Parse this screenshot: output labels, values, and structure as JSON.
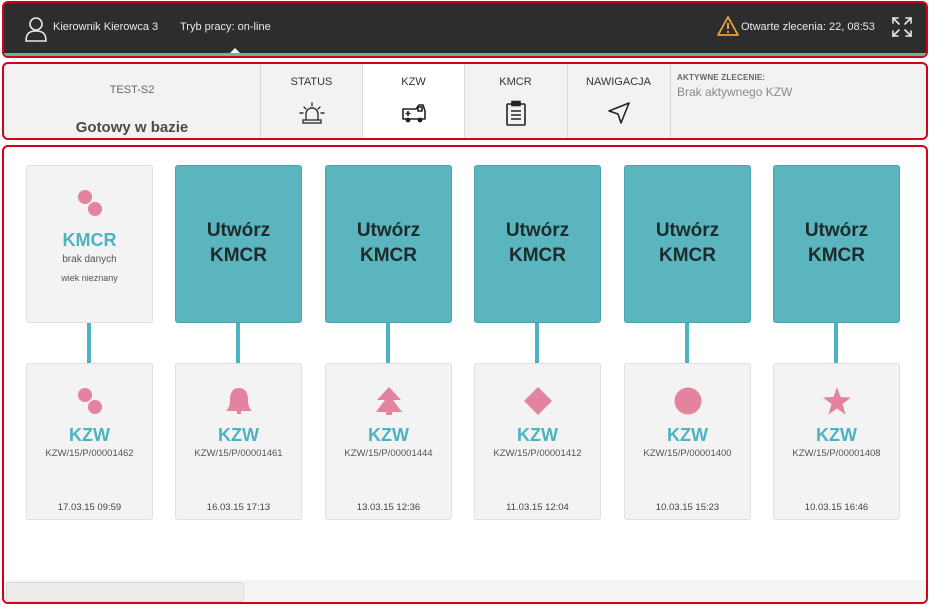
{
  "topbar": {
    "user_name": "Kierownik Kierowca 3",
    "work_mode": "Tryb pracy: on-line",
    "open_orders": "Otwarte zlecenia: 22, 08:53"
  },
  "vehicle": {
    "id": "TEST-S2",
    "status": "Gotowy w bazie"
  },
  "tabs": [
    {
      "label": "STATUS",
      "icon": "siren-icon",
      "active": false
    },
    {
      "label": "KZW",
      "icon": "ambulance-icon",
      "active": true
    },
    {
      "label": "KMCR",
      "icon": "clipboard-icon",
      "active": false
    },
    {
      "label": "NAWIGACJA",
      "icon": "navigation-arrow-icon",
      "active": false
    }
  ],
  "active_order": {
    "title": "AKTYWNE ZLECENIE:",
    "value": "Brak aktywnego KZW"
  },
  "cards": [
    {
      "top": {
        "type": "info",
        "label": "KMCR",
        "line1": "brak danych",
        "line2": "wiek nieznany",
        "icon": "two-dots-icon"
      },
      "bottom": {
        "shape": "two-dots",
        "label": "KZW",
        "number": "KZW/15/P/00001462",
        "date": "17.03.15 09:59"
      }
    },
    {
      "top": {
        "type": "create",
        "line1": "Utwórz",
        "line2": "KMCR"
      },
      "bottom": {
        "shape": "bell",
        "label": "KZW",
        "number": "KZW/15/P/00001461",
        "date": "16.03.15 17:13"
      }
    },
    {
      "top": {
        "type": "create",
        "line1": "Utwórz",
        "line2": "KMCR"
      },
      "bottom": {
        "shape": "tree",
        "label": "KZW",
        "number": "KZW/15/P/00001444",
        "date": "13.03.15 12:36"
      }
    },
    {
      "top": {
        "type": "create",
        "line1": "Utwórz",
        "line2": "KMCR"
      },
      "bottom": {
        "shape": "diamond",
        "label": "KZW",
        "number": "KZW/15/P/00001412",
        "date": "11.03.15 12:04"
      }
    },
    {
      "top": {
        "type": "create",
        "line1": "Utwórz",
        "line2": "KMCR"
      },
      "bottom": {
        "shape": "circle",
        "label": "KZW",
        "number": "KZW/15/P/00001400",
        "date": "10.03.15 15:23"
      }
    },
    {
      "top": {
        "type": "create",
        "line1": "Utwórz",
        "line2": "KMCR"
      },
      "bottom": {
        "shape": "star",
        "label": "KZW",
        "number": "KZW/15/P/00001408",
        "date": "10.03.15 16:46"
      }
    }
  ],
  "colors": {
    "accent_teal": "#4cb3bf",
    "create_card": "#5bb5be",
    "shape_pink": "#e3839f",
    "highlight_red": "#d0021b",
    "topbar_bg": "#2d2d2d"
  }
}
